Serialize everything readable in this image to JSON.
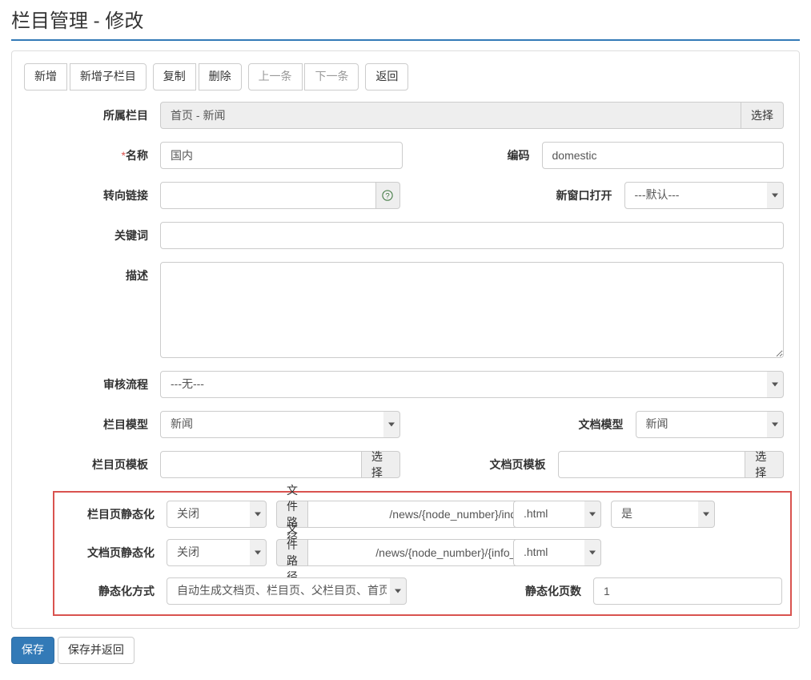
{
  "page_title": "栏目管理 - 修改",
  "toolbar": {
    "new": "新增",
    "new_child": "新增子栏目",
    "copy": "复制",
    "delete": "删除",
    "prev": "上一条",
    "next": "下一条",
    "back": "返回"
  },
  "labels": {
    "parent": "所属栏目",
    "name": "名称",
    "code": "编码",
    "redirect": "转向链接",
    "new_window": "新窗口打开",
    "keywords": "关键词",
    "description": "描述",
    "audit": "审核流程",
    "node_model": "栏目模型",
    "doc_model": "文档模型",
    "node_tpl": "栏目页模板",
    "doc_tpl": "文档页模板",
    "node_static": "栏目页静态化",
    "doc_static": "文档页静态化",
    "static_mode": "静态化方式",
    "static_pages": "静态化页数",
    "select": "选择",
    "file_path": "文件路径"
  },
  "values": {
    "parent_path": "首页 - 新闻",
    "name": "国内",
    "code": "domestic",
    "redirect": "",
    "new_window": "---默认---",
    "keywords": "",
    "description": "",
    "audit": "---无---",
    "node_model": "新闻",
    "doc_model": "新闻",
    "node_tpl": "",
    "doc_tpl": "",
    "node_static_enable": "关闭",
    "node_static_path": "/news/{node_number}/index",
    "node_static_ext": ".html",
    "node_static_yes": "是",
    "doc_static_enable": "关闭",
    "doc_static_path": "/news/{node_number}/{info_id}",
    "doc_static_ext": ".html",
    "static_mode": "自动生成文档页、栏目页、父栏目页、首页",
    "static_pages": "1"
  },
  "footer": {
    "save": "保存",
    "save_back": "保存并返回"
  }
}
